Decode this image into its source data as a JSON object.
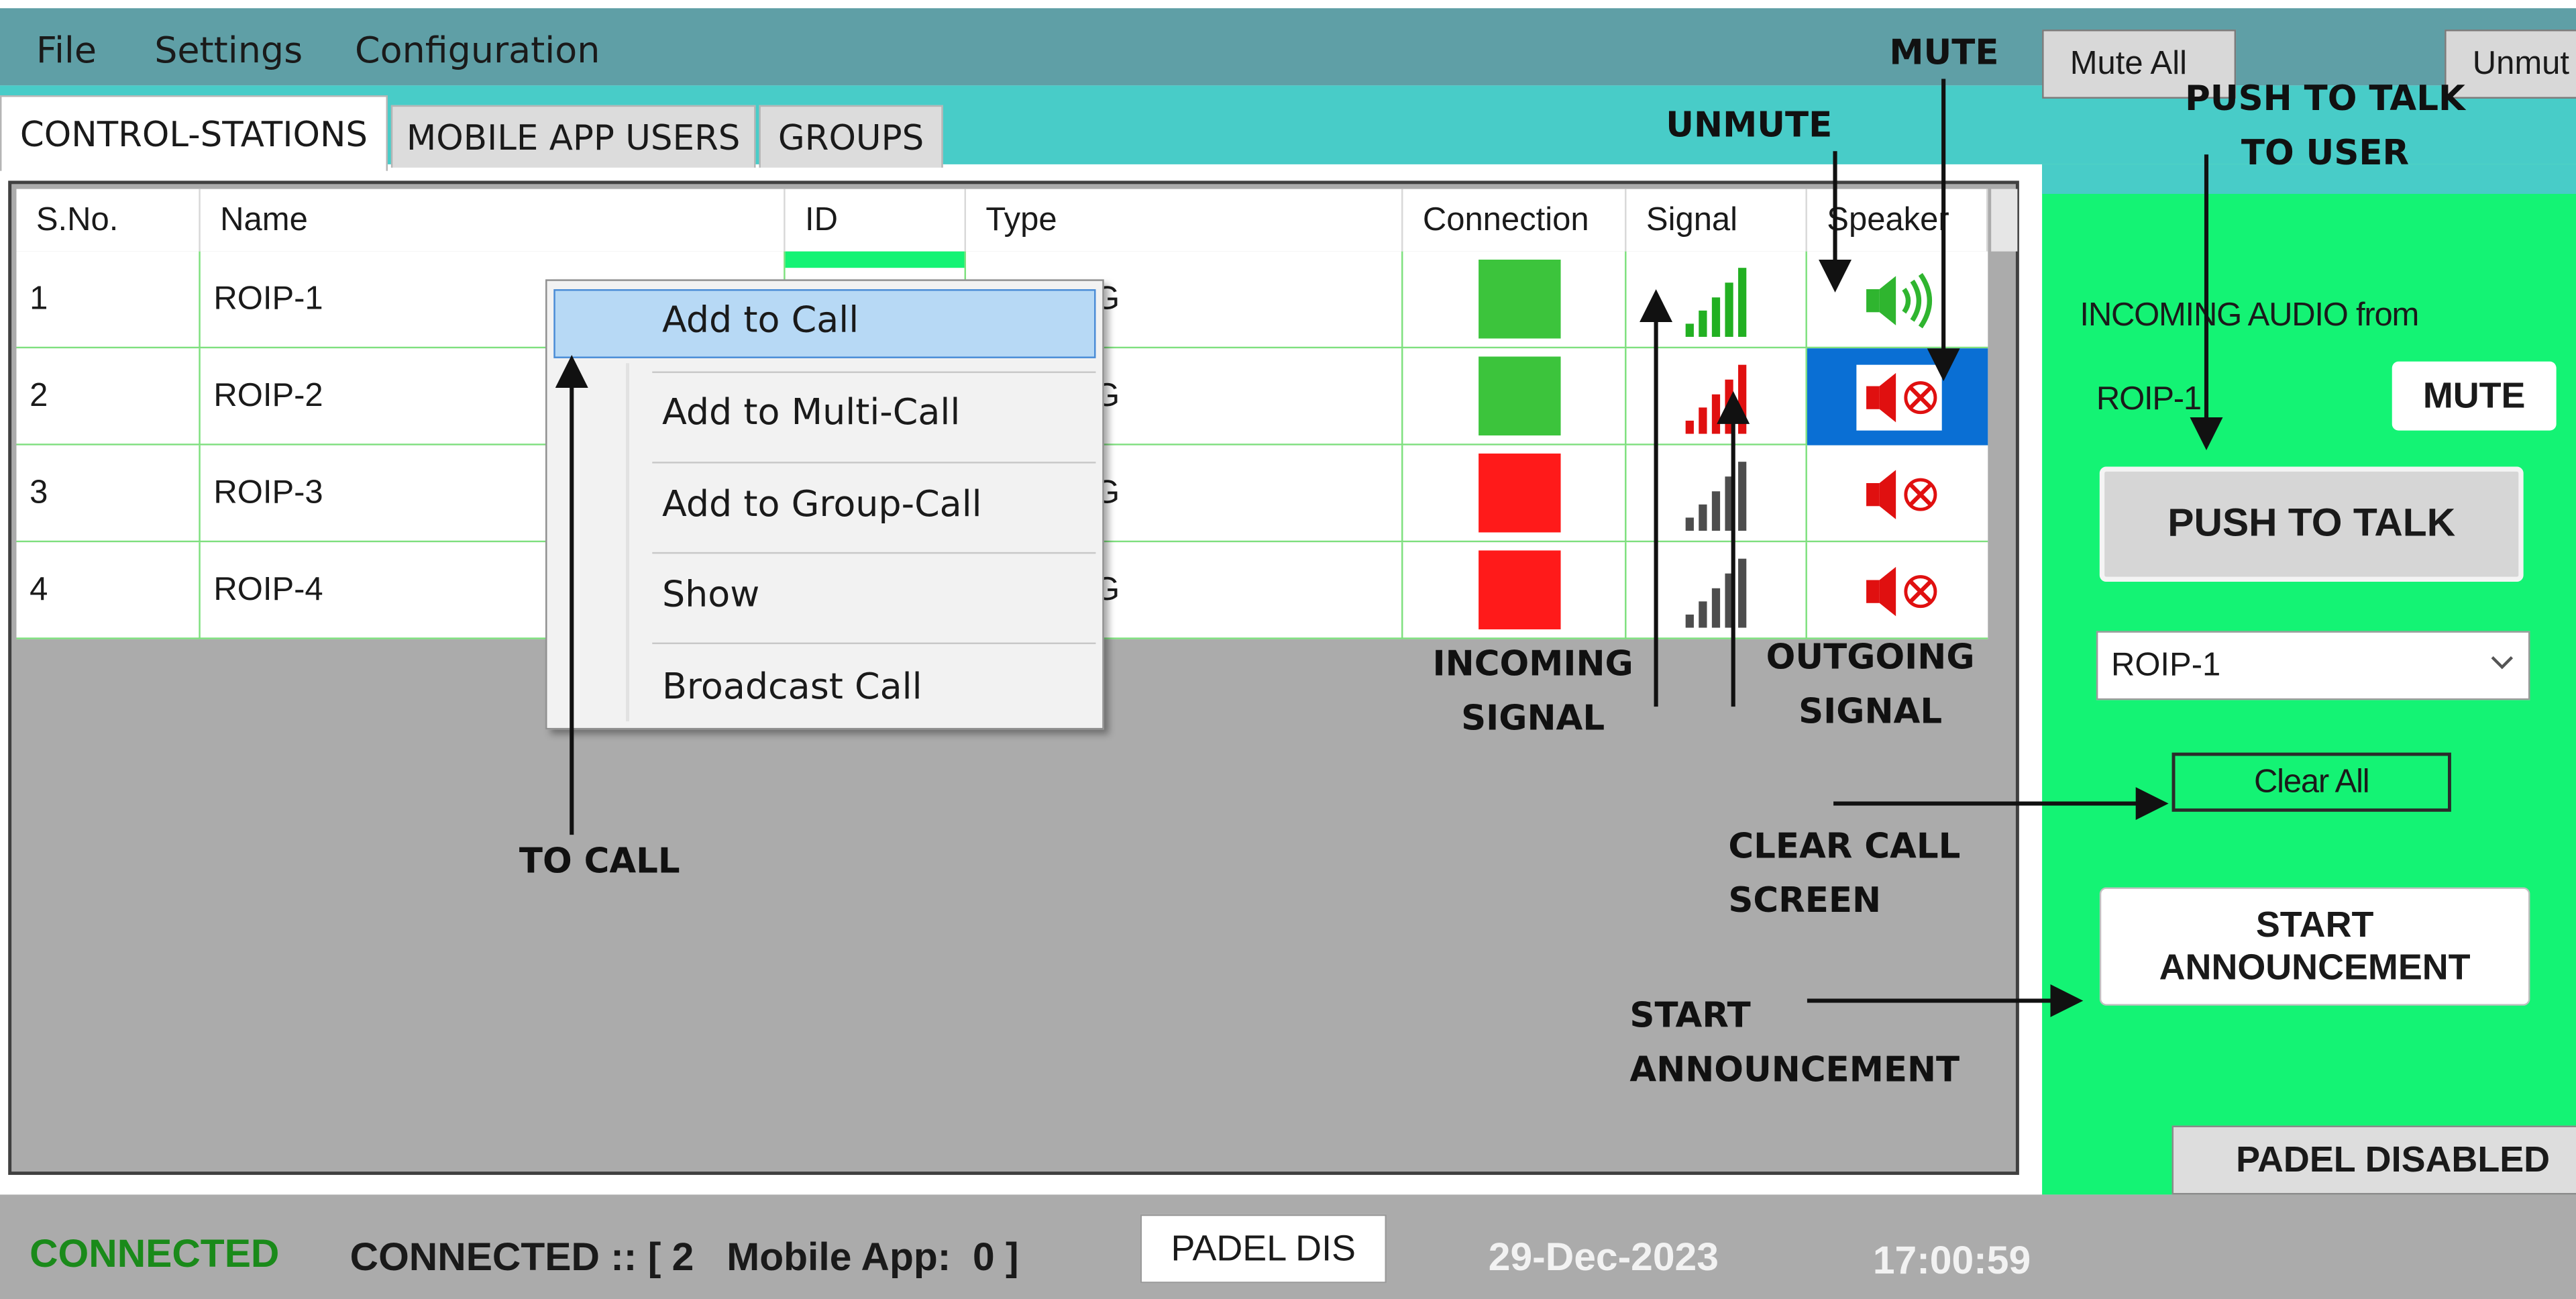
{
  "menu": {
    "file": "File",
    "settings": "Settings",
    "configuration": "Configuration"
  },
  "tabs": {
    "control_stations": "CONTROL-STATIONS",
    "mobile_app_users": "MOBILE APP USERS",
    "groups": "GROUPS"
  },
  "grid": {
    "headers": {
      "sno": "S.No.",
      "name": "Name",
      "id": "ID",
      "type": "Type",
      "connection": "Connection",
      "signal": "Signal",
      "speaker": "Speaker"
    },
    "rows": [
      {
        "sno": "1",
        "name": "ROIP-1",
        "type_fragment": "G",
        "connection": "connected",
        "incoming_bars": 5,
        "outgoing_bars": 0,
        "speaker": "unmuted",
        "speaker_icon": "speaker-on-icon"
      },
      {
        "sno": "2",
        "name": "ROIP-2",
        "type_fragment": "G",
        "connection": "connected",
        "incoming_bars": 0,
        "outgoing_bars": 4,
        "speaker": "muted",
        "speaker_icon": "speaker-muted-icon"
      },
      {
        "sno": "3",
        "name": "ROIP-3",
        "type_fragment": "G",
        "connection": "disconnected",
        "incoming_bars": 0,
        "outgoing_bars": 0,
        "speaker": "muted",
        "speaker_icon": "speaker-muted-icon"
      },
      {
        "sno": "4",
        "name": "ROIP-4",
        "type_fragment": "G",
        "connection": "disconnected",
        "incoming_bars": 0,
        "outgoing_bars": 0,
        "speaker": "muted",
        "speaker_icon": "speaker-muted-icon"
      }
    ]
  },
  "context_menu": {
    "add_to_call": "Add to Call",
    "add_to_multi_call": "Add to Multi-Call",
    "add_to_group_call": "Add to Group-Call",
    "show": "Show",
    "broadcast_call": "Broadcast Call"
  },
  "right_panel": {
    "mute_all": "Mute All",
    "unmute_all": "Unmut",
    "incoming_audio_label": "INCOMING AUDIO from",
    "incoming_source": "ROIP-1",
    "mute_button": "MUTE",
    "push_to_talk": "PUSH TO TALK",
    "selected_station": "ROIP-1",
    "clear_all": "Clear All",
    "start_announcement_line1": "START",
    "start_announcement_line2": "ANNOUNCEMENT",
    "padel_disabled": "PADEL DISABLED"
  },
  "status_bar": {
    "connected": "CONNECTED",
    "connected_count": "CONNECTED :: [ 2   Mobile App:  0 ]",
    "padel_dis": "PADEL DIS",
    "date": "29-Dec-2023",
    "time": "17:00:59"
  },
  "annotations": {
    "mute": "MUTE",
    "unmute": "UNMUTE",
    "push_to_talk_line1": "PUSH TO TALK",
    "push_to_talk_line2": "TO USER",
    "incoming_signal_line1": "INCOMING",
    "incoming_signal_line2": "SIGNAL",
    "outgoing_signal_line1": "OUTGOING",
    "outgoing_signal_line2": "SIGNAL",
    "to_call": "TO CALL",
    "clear_call_line1": "CLEAR CALL",
    "clear_call_line2": "SCREEN",
    "start_announcement_line1": "START",
    "start_announcement_line2": "ANNOUNCEMENT"
  },
  "colors": {
    "menubar": "#5f9fa6",
    "tabstrip": "#48ccc8",
    "panel_green": "#14f374",
    "connected_green": "#3cc43c",
    "disconnected_red": "#ff1a1a",
    "status_connected_text": "#1a8a1a",
    "selection_blue": "#0a6fd4"
  }
}
